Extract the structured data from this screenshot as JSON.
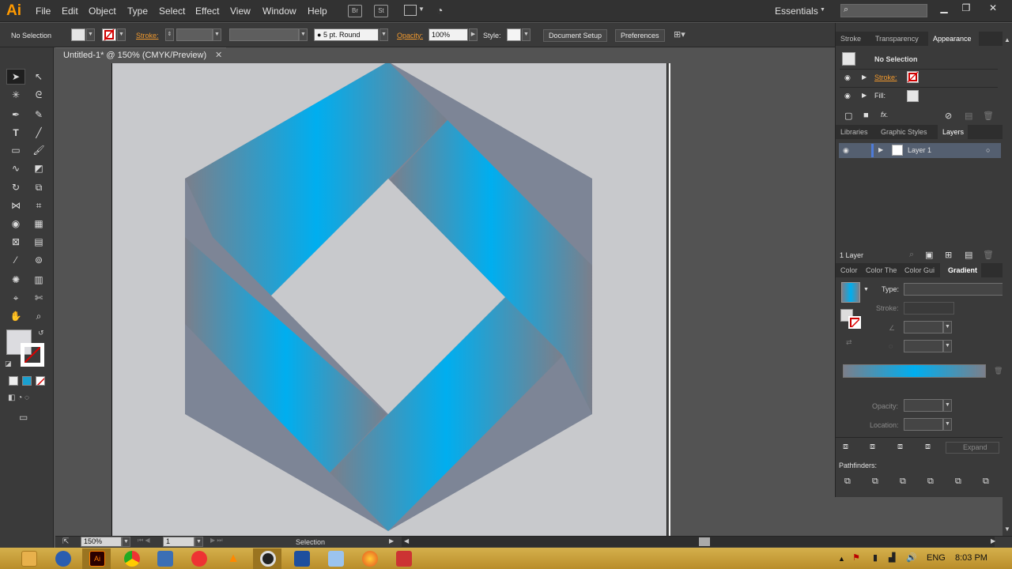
{
  "app": {
    "logo": "Ai"
  },
  "menu": [
    "File",
    "Edit",
    "Object",
    "Type",
    "Select",
    "Effect",
    "View",
    "Window",
    "Help"
  ],
  "toolbar_icons": {
    "br": "Br",
    "st": "St"
  },
  "workspace": "Essentials",
  "control": {
    "selection": "No Selection",
    "stroke_label": "Stroke:",
    "brush": "5 pt. Round",
    "opacity_label": "Opacity:",
    "opacity_value": "100%",
    "style_label": "Style:",
    "doc_setup": "Document Setup",
    "preferences": "Preferences"
  },
  "document": {
    "tab_title": "Untitled-1* @ 150% (CMYK/Preview)"
  },
  "appearance": {
    "tabs": [
      "Stroke",
      "Transparency",
      "Appearance"
    ],
    "title": "No Selection",
    "stroke_label": "Stroke:",
    "fill_label": "Fill:",
    "fx": "fx."
  },
  "layers": {
    "tabs": [
      "Libraries",
      "Graphic Styles",
      "Layers"
    ],
    "layer_name": "Layer 1",
    "count": "1 Layer"
  },
  "gradient": {
    "tabs": [
      "Color",
      "Color The",
      "Color Gui",
      "Gradient"
    ],
    "type_label": "Type:",
    "stroke_label": "Stroke:",
    "opacity_label": "Opacity:",
    "location_label": "Location:",
    "expand": "Expand",
    "pathfinders": "Pathfinders:"
  },
  "status": {
    "zoom": "150%",
    "page": "1",
    "tool": "Selection"
  },
  "taskbar": {
    "lang": "ENG",
    "time": "8:03 PM"
  },
  "colors": {
    "blue": "#00aeef",
    "gray": "#7b7f8b",
    "artboard": "#c8c9cc"
  }
}
